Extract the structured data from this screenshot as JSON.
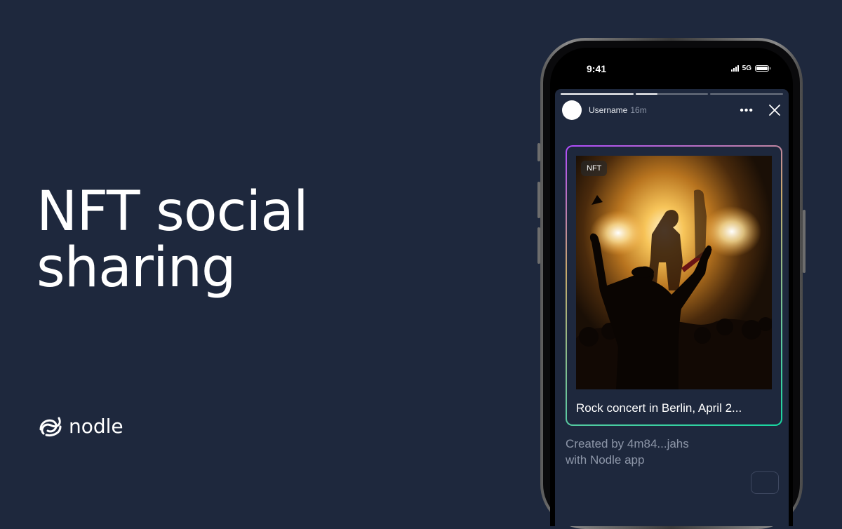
{
  "headline": {
    "line1": "NFT social",
    "line2": "sharing"
  },
  "brand": {
    "name": "nodle",
    "logo": "nodle-logo-icon"
  },
  "phone": {
    "status": {
      "time": "9:41",
      "network": "5G"
    },
    "story": {
      "progress": [
        1.0,
        0.3,
        0.0
      ],
      "username": "Username",
      "time_ago": "16m",
      "more_icon": "ellipsis-icon",
      "close_icon": "close-icon"
    },
    "nft": {
      "badge": "NFT",
      "title": "Rock concert in Berlin, April 2...",
      "image": "concert-photo"
    },
    "created": {
      "line1": "Created by 4m84...jahs",
      "line2": "with Nodle app"
    }
  },
  "colors": {
    "background": "#1e283d",
    "card_gradient_start": "#b04bff",
    "card_gradient_end": "#17d6a0"
  }
}
